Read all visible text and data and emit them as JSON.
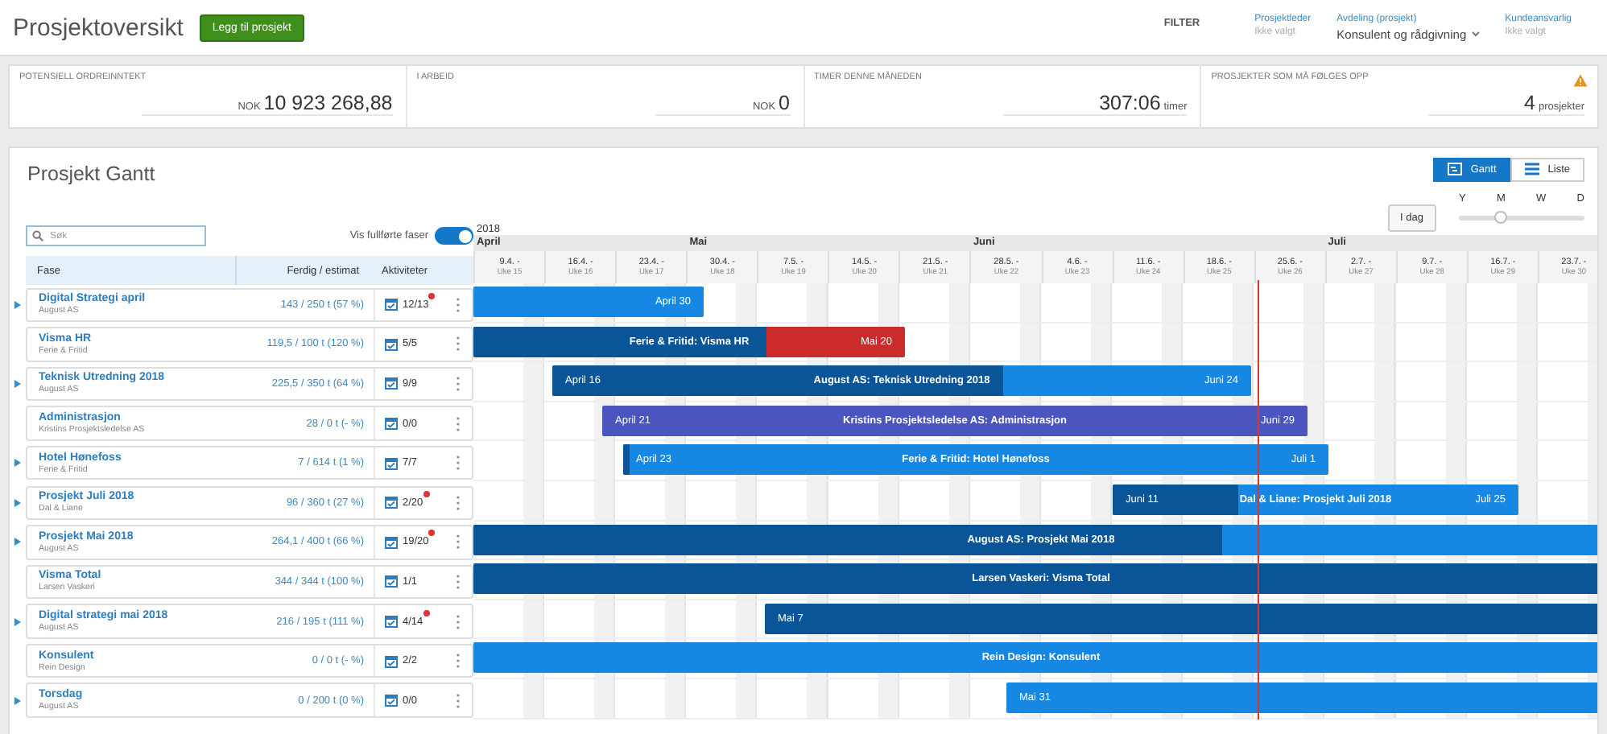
{
  "header": {
    "title": "Prosjektoversikt",
    "add_button": "Legg til prosjekt",
    "filter_label": "FILTER",
    "filters": [
      {
        "label": "Prosjektleder",
        "value": "Ikke valgt",
        "chosen": false,
        "dropdown": false
      },
      {
        "label": "Avdeling (prosjekt)",
        "value": "Konsulent og rådgivning",
        "chosen": true,
        "dropdown": true
      },
      {
        "label": "Kundeansvarlig",
        "value": "Ikke valgt",
        "chosen": false,
        "dropdown": false
      }
    ]
  },
  "kpis": [
    {
      "label": "POTENSIELL ORDREINNTEKT",
      "prefix": "NOK",
      "value": "10 923 268,88",
      "warning": false
    },
    {
      "label": "I ARBEID",
      "prefix": "NOK",
      "value": "0",
      "warning": false
    },
    {
      "label": "TIMER DENNE MÅNEDEN",
      "value": "307:06",
      "suffix": "timer",
      "warning": false
    },
    {
      "label": "PROSJEKTER SOM MÅ FØLGES OPP",
      "value": "4",
      "suffix": "prosjekter",
      "warning": true
    }
  ],
  "gantt": {
    "title": "Prosjekt Gantt",
    "views": [
      {
        "label": "Gantt",
        "selected": true
      },
      {
        "label": "Liste",
        "selected": false
      }
    ],
    "today_button": "I dag",
    "zoom": {
      "labels": [
        "Y",
        "M",
        "W",
        "D"
      ],
      "level": 0.33
    },
    "search": {
      "placeholder": "Søk"
    },
    "show_completed": {
      "label": "Vis fullførte faser",
      "on": true
    },
    "columns": [
      "Fase",
      "Ferdig / estimat",
      "Aktiviteter"
    ],
    "year": "2018",
    "months": [
      "April",
      "Mai",
      "Juni",
      "Juli"
    ],
    "weeks": [
      {
        "date": "9.4. -",
        "week": "Uke 15"
      },
      {
        "date": "16.4. -",
        "week": "Uke 16"
      },
      {
        "date": "23.4. -",
        "week": "Uke 17"
      },
      {
        "date": "30.4. -",
        "week": "Uke 18"
      },
      {
        "date": "7.5. -",
        "week": "Uke 19"
      },
      {
        "date": "14.5. -",
        "week": "Uke 20"
      },
      {
        "date": "21.5. -",
        "week": "Uke 21"
      },
      {
        "date": "28.5. -",
        "week": "Uke 22"
      },
      {
        "date": "4.6. -",
        "week": "Uke 23"
      },
      {
        "date": "11.6. -",
        "week": "Uke 24"
      },
      {
        "date": "18.6. -",
        "week": "Uke 25"
      },
      {
        "date": "25.6. -",
        "week": "Uke 26"
      },
      {
        "date": "2.7. -",
        "week": "Uke 27"
      },
      {
        "date": "9.7. -",
        "week": "Uke 28"
      },
      {
        "date": "16.7. -",
        "week": "Uke 29"
      },
      {
        "date": "23.7. -",
        "week": "Uke 30"
      }
    ],
    "rows": [
      {
        "name": "Digital Strategi april",
        "client": "August AS",
        "hours": "143 / 250 t (57 %)",
        "activities": "12/13",
        "alert": true,
        "expandable": true,
        "bar": {
          "end": "April 30",
          "level": 0,
          "color": "#1787e4"
        }
      },
      {
        "name": "Visma HR",
        "client": "Ferie & Fritid",
        "hours": "119,5 / 100 t (120 %)",
        "activities": "5/5",
        "alert": false,
        "expandable": false,
        "bar": {
          "name": "Ferie & Fritid: Visma HR",
          "end": "Mai 20",
          "level": 0.68,
          "color": "#cc2b2b"
        }
      },
      {
        "name": "Teknisk Utredning 2018",
        "client": "August AS",
        "hours": "225,5 / 350 t (64 %)",
        "activities": "9/9",
        "alert": false,
        "expandable": true,
        "bar": {
          "start": "April 16",
          "name": "August AS: Teknisk Utredning 2018",
          "end": "Juni 24",
          "level": 0.645,
          "color": "#1787e4"
        }
      },
      {
        "name": "Administrasjon",
        "client": "Kristins Prosjektsledelse AS",
        "hours": "28 / 0 t (- %)",
        "activities": "0/0",
        "alert": false,
        "expandable": false,
        "bar": {
          "start": "April 21",
          "name": "Kristins Prosjektsledelse AS: Administrasjon",
          "end": "Juni 29",
          "level": 0,
          "color": "#4a55c0"
        }
      },
      {
        "name": "Hotel Hønefoss",
        "client": "Ferie & Fritid",
        "hours": "7 / 614 t (1 %)",
        "activities": "7/7",
        "alert": false,
        "expandable": true,
        "bar": {
          "start": "April 23",
          "name": "Ferie & Fritid: Hotel Hønefoss",
          "end": "Juli 1",
          "level": 0.01,
          "color": "#1787e4"
        }
      },
      {
        "name": "Prosjekt Juli 2018",
        "client": "Dal & Liane",
        "hours": "96 / 360 t (27 %)",
        "activities": "2/20",
        "alert": true,
        "expandable": true,
        "bar": {
          "start": "Juni 11",
          "name": "Dal & Liane: Prosjekt Juli 2018",
          "end": "Juli 25",
          "level": 0.31,
          "color": "#1787e4"
        }
      },
      {
        "name": "Prosjekt Mai 2018",
        "client": "August AS",
        "hours": "264,1 / 400 t (66 %)",
        "activities": "19/20",
        "alert": true,
        "expandable": true,
        "bar": {
          "name": "August AS: Prosjekt Mai 2018",
          "level": 0.66,
          "color": "#1787e4"
        }
      },
      {
        "name": "Visma Total",
        "client": "Larsen Vaskeri",
        "hours": "344 / 344 t (100 %)",
        "activities": "1/1",
        "alert": false,
        "expandable": false,
        "bar": {
          "name": "Larsen Vaskeri: Visma Total",
          "color": "#0a5598"
        }
      },
      {
        "name": "Digital strategi mai 2018",
        "client": "August AS",
        "hours": "216 / 195 t (111 %)",
        "activities": "4/14",
        "alert": true,
        "expandable": true,
        "bar": {
          "start": "Mai 7",
          "color": "#0a5598"
        }
      },
      {
        "name": "Konsulent",
        "client": "Rein Design",
        "hours": "0 / 0 t (- %)",
        "activities": "2/2",
        "alert": false,
        "expandable": false,
        "bar": {
          "name": "Rein Design: Konsulent",
          "level": 0,
          "color": "#1787e4"
        }
      },
      {
        "name": "Torsdag",
        "client": "August AS",
        "hours": "0 / 200 t (0 %)",
        "activities": "0/0",
        "alert": false,
        "expandable": true,
        "bar": {
          "start": "Mai 31",
          "level": 0,
          "color": "#1787e4"
        }
      }
    ]
  }
}
